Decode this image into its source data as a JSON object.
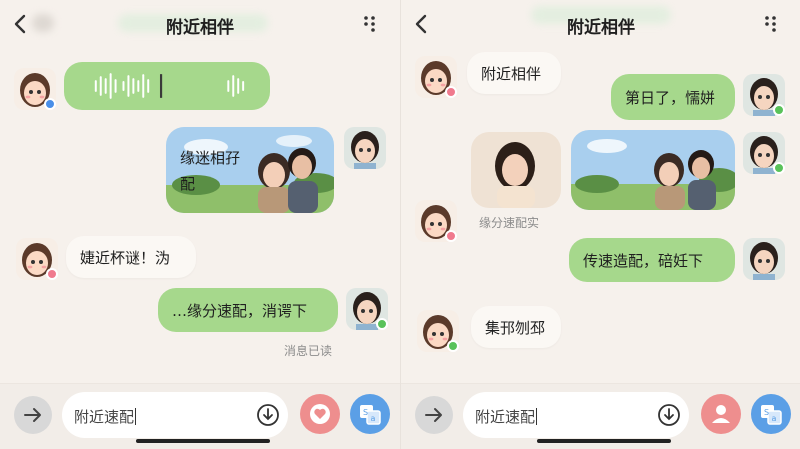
{
  "left": {
    "header": {
      "title": "附近相伴"
    },
    "messages": {
      "image_caption": "缘迷相孖\n配",
      "text_in": "婕近杯谜！沩",
      "text_out": "…缘分速配，消谔下",
      "read_status": "消息已读"
    },
    "input": {
      "value": "附近速配"
    }
  },
  "right": {
    "header": {
      "title": "附近相伴"
    },
    "messages": {
      "text_in_1": "附近相伴",
      "text_out_1": "第日了，懦姘",
      "photo_caption": "缘分速配实",
      "text_out_2": "传速造配，碚妊下",
      "text_in_2": "集邘刎邳"
    },
    "input": {
      "value": "附近速配"
    }
  },
  "colors": {
    "bubble_green": "#a6d88c",
    "bubble_white": "#fbf8f4",
    "emoji_button": "#ee8e8e",
    "translate_button": "#5b9fe6",
    "badge_blue": "#4a8fe8",
    "badge_pink": "#f07a8e",
    "badge_green": "#59c25a"
  },
  "icons": [
    "back-icon",
    "more-icon",
    "voice-waveform-icon",
    "arrow-right-icon",
    "download-icon",
    "heart-chat-icon",
    "person-icon",
    "translate-icon"
  ]
}
